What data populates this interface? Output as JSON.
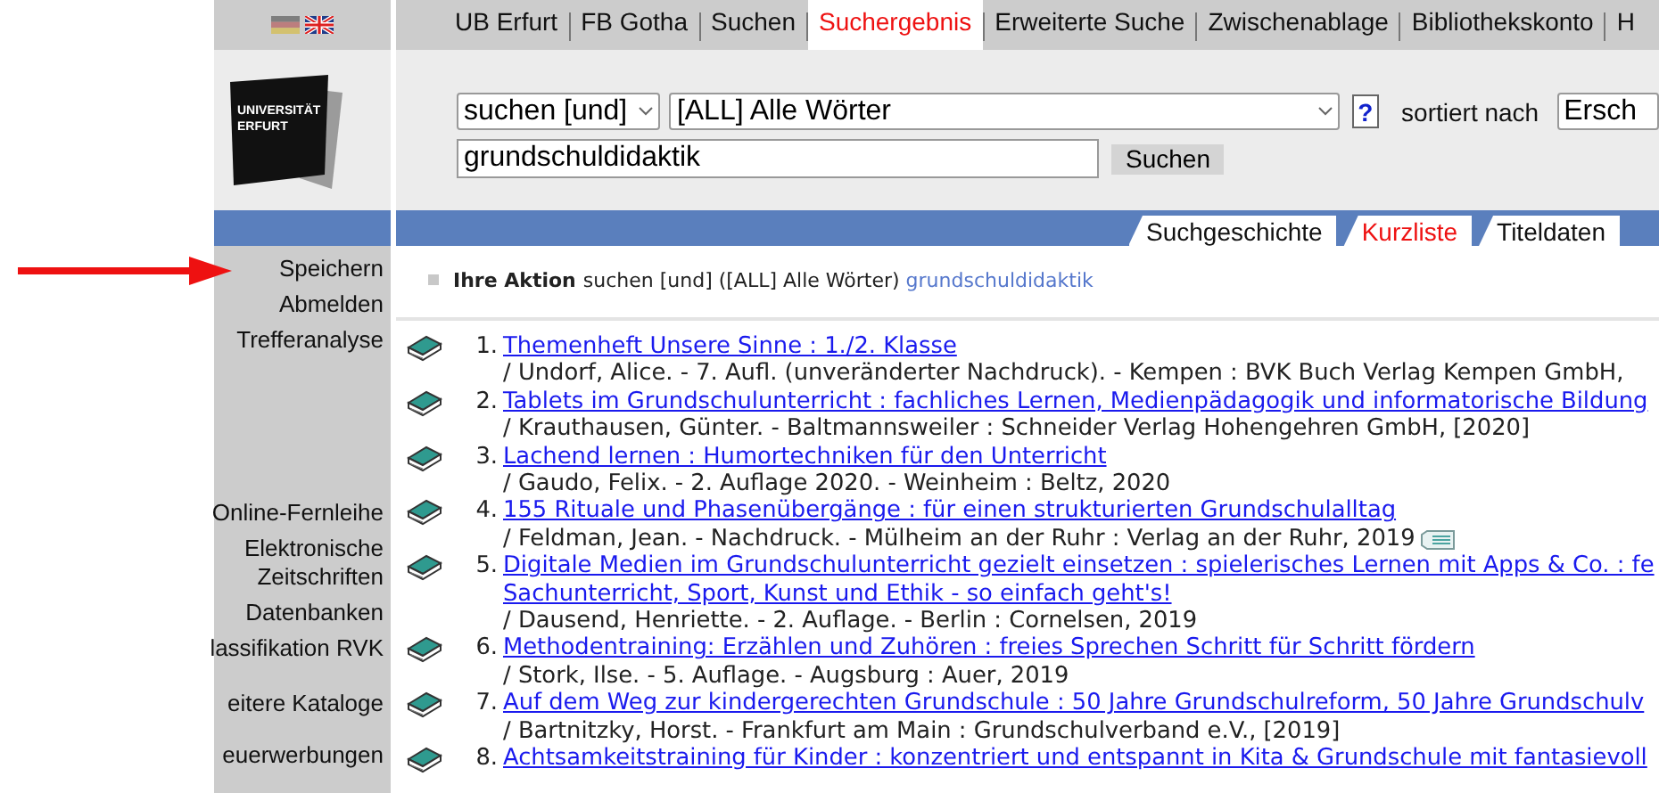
{
  "top_nav": {
    "languages": [
      {
        "kind": "de",
        "selected": false
      },
      {
        "kind": "en",
        "selected": true
      }
    ],
    "items": [
      {
        "label": "UB Erfurt",
        "selected": false
      },
      {
        "label": "FB Gotha",
        "selected": false
      },
      {
        "label": "Suchen",
        "selected": false
      },
      {
        "label": "Suchergebnis",
        "selected": true
      },
      {
        "label": "Erweiterte Suche",
        "selected": false
      },
      {
        "label": "Zwischenablage",
        "selected": false
      },
      {
        "label": "Bibliothekskonto",
        "selected": false
      },
      {
        "label": "H",
        "selected": false
      }
    ]
  },
  "logo": {
    "lines": [
      "UNIVERSITÄT",
      "ERFURT"
    ]
  },
  "search": {
    "operator": "suchen [und]",
    "index": "[ALL] Alle Wörter",
    "help": "?",
    "sort_label": "sortiert nach",
    "sort_value": "Ersch",
    "query": "grundschuldidaktik",
    "button": "Suchen"
  },
  "view_tabs": [
    {
      "label": "Suchgeschichte",
      "selected": false
    },
    {
      "label": "Kurzliste",
      "selected": true
    },
    {
      "label": "Titeldaten",
      "selected": false
    }
  ],
  "sidebar": {
    "groups": [
      [
        "Speichern",
        "Abmelden",
        "Trefferanalyse"
      ],
      [
        "Online-Fernleihe",
        "Elektronische Zeitschriften",
        "Datenbanken",
        "lassifikation RVK"
      ],
      [
        "eitere Kataloge"
      ],
      [
        "euerwerbungen"
      ]
    ]
  },
  "action": {
    "label": "Ihre Aktion",
    "text": "suchen [und] ([ALL] Alle Wörter)",
    "query": "grundschuldidaktik"
  },
  "results": [
    {
      "number": "1.",
      "title_lines": [
        "Themenheft Unsere Sinne : 1./2. Klasse"
      ],
      "details": "/ Undorf, Alice. - 7. Aufl. (unveränderter Nachdruck). - Kempen : BVK Buch Verlag Kempen GmbH,",
      "online": false
    },
    {
      "number": "2.",
      "title_lines": [
        "Tablets im Grundschulunterricht : fachliches Lernen, Medienpädagogik und informatorische Bildung"
      ],
      "details": "/ Krauthausen, Günter. - Baltmannsweiler : Schneider Verlag Hohengehren GmbH, [2020]",
      "online": false
    },
    {
      "number": "3.",
      "title_lines": [
        "Lachend lernen : Humortechniken für den Unterricht"
      ],
      "details": "/ Gaudo, Felix. - 2. Auflage 2020. - Weinheim : Beltz, 2020",
      "online": false
    },
    {
      "number": "4.",
      "title_lines": [
        "155 Rituale und Phasenübergänge : für einen strukturierten Grundschulalltag"
      ],
      "details": "/ Feldman, Jean. - Nachdruck. - Mülheim an der Ruhr : Verlag an der Ruhr, 2019",
      "online": true
    },
    {
      "number": "5.",
      "title_lines": [
        "Digitale Medien im Grundschulunterricht gezielt einsetzen : spielerisches Lernen mit Apps & Co. : fe",
        "Sachunterricht, Sport, Kunst und Ethik - so einfach geht's!"
      ],
      "details": "/ Dausend, Henriette. - 2. Auflage. - Berlin : Cornelsen, 2019",
      "online": false
    },
    {
      "number": "6.",
      "title_lines": [
        "Methodentraining: Erzählen und Zuhören : freies Sprechen Schritt für Schritt fördern"
      ],
      "details": "/ Stork, Ilse. - 5. Auflage. - Augsburg : Auer, 2019",
      "online": false
    },
    {
      "number": "7.",
      "title_lines": [
        "Auf dem Weg zur kindergerechten Grundschule : 50 Jahre Grundschulreform, 50 Jahre Grundschulv"
      ],
      "details": "/ Bartnitzky, Horst. - Frankfurt am Main : Grundschulverband e.V., [2019]",
      "online": false
    },
    {
      "number": "8.",
      "title_lines": [
        "Achtsamkeitstraining für Kinder : konzentriert und entspannt in Kita & Grundschule mit fantasievoll"
      ]
    }
  ]
}
